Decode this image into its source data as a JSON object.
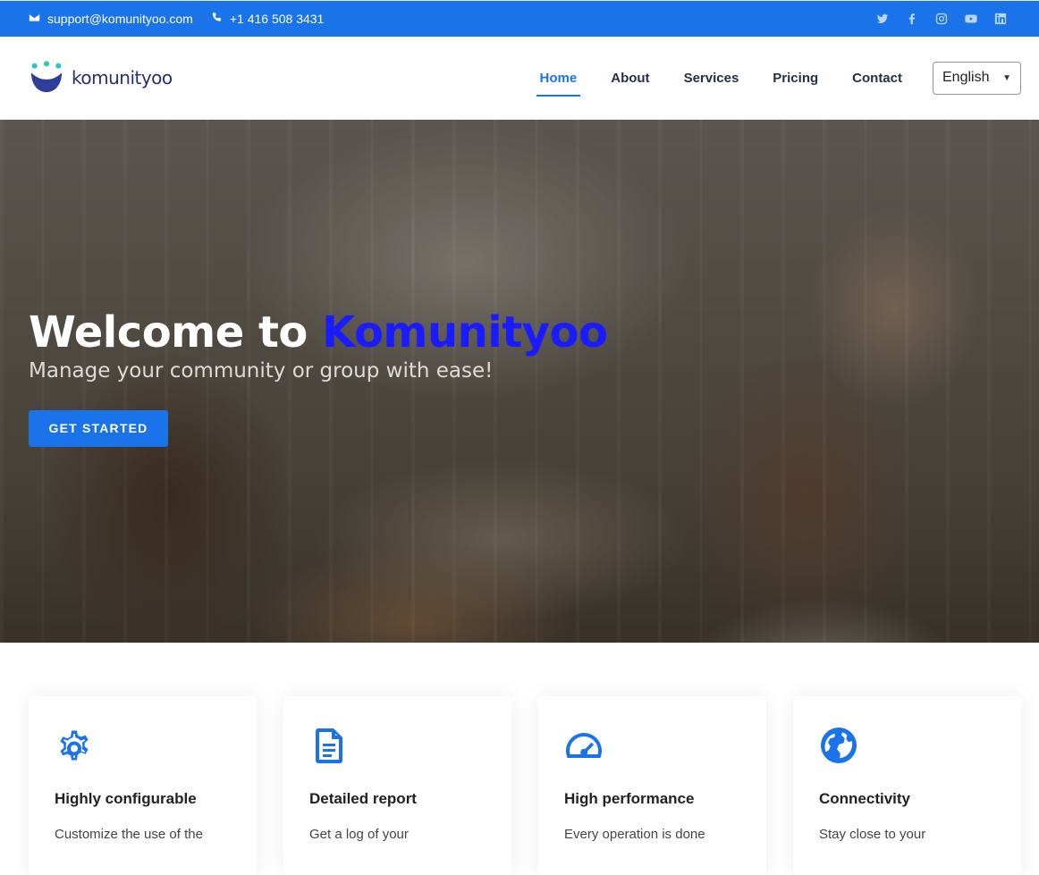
{
  "topbar": {
    "email": "support@komunityoo.com",
    "phone": "+1 416 508 3431",
    "socials": [
      "twitter-icon",
      "facebook-icon",
      "instagram-icon",
      "youtube-icon",
      "linkedin-icon"
    ]
  },
  "header": {
    "logo_text": "komunityoo",
    "nav": [
      {
        "label": "Home",
        "active": true
      },
      {
        "label": "About"
      },
      {
        "label": "Services"
      },
      {
        "label": "Pricing"
      },
      {
        "label": "Contact"
      }
    ],
    "language": "English"
  },
  "hero": {
    "title_prefix": "Welcome to ",
    "title_brand": "Komunityoo",
    "subtitle": "Manage your community or group with ease!",
    "cta_label": "GET STARTED"
  },
  "features": [
    {
      "icon": "gear-icon",
      "title": "Highly configurable",
      "text": "Customize the use of the"
    },
    {
      "icon": "document-icon",
      "title": "Detailed report",
      "text": "Get a log of your"
    },
    {
      "icon": "speedometer-icon",
      "title": "High performance",
      "text": "Every operation is done"
    },
    {
      "icon": "globe-icon",
      "title": "Connectivity",
      "text": "Stay close to your"
    }
  ],
  "colors": {
    "primary": "#1a73e8",
    "brand_text": "#1b1bff",
    "logo_text": "#2b2f6e"
  }
}
